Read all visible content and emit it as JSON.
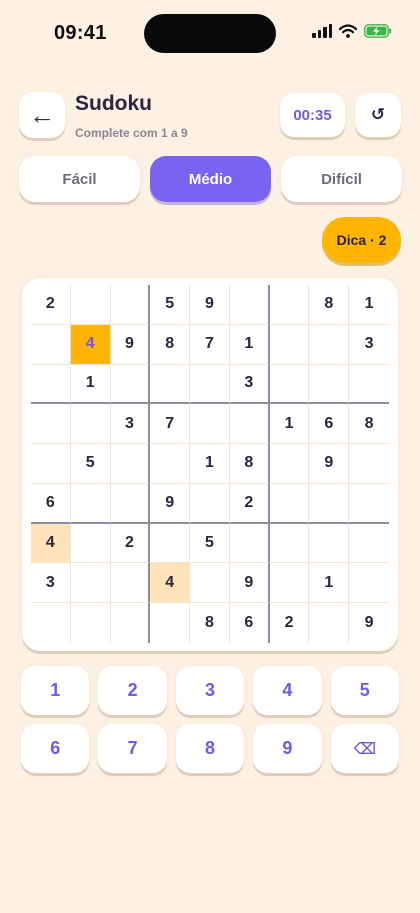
{
  "status_bar": {
    "time": "09:41"
  },
  "header": {
    "back_icon": "←",
    "title": "Sudoku",
    "subtitle": "Complete com 1 a 9",
    "timer": "00:35",
    "reset_icon": "↺"
  },
  "difficulty": {
    "options": [
      "Fácil",
      "Médio",
      "Difícil"
    ],
    "selected": "Médio"
  },
  "hint": {
    "label": "Dica · 2"
  },
  "board": {
    "rows": [
      [
        "2",
        "",
        "",
        "5",
        "9",
        "",
        "",
        "8",
        "1"
      ],
      [
        "",
        "4",
        "9",
        "8",
        "7",
        "1",
        "",
        "",
        "3"
      ],
      [
        "",
        "1",
        "",
        "",
        "",
        "3",
        "",
        "",
        ""
      ],
      [
        "",
        "",
        "3",
        "7",
        "",
        "",
        "1",
        "6",
        "8"
      ],
      [
        "",
        "5",
        "",
        "",
        "1",
        "8",
        "",
        "9",
        ""
      ],
      [
        "6",
        "",
        "",
        "9",
        "",
        "2",
        "",
        "",
        ""
      ],
      [
        "4",
        "",
        "2",
        "",
        "5",
        "",
        "",
        "",
        ""
      ],
      [
        "3",
        "",
        "",
        "4",
        "",
        "9",
        "",
        "1",
        ""
      ],
      [
        "",
        "",
        "",
        "",
        "8",
        "6",
        "2",
        "",
        "9"
      ]
    ],
    "selected_cell": {
      "row": 2,
      "col": 2,
      "color": "#FFB400"
    },
    "highlighted_cells": [
      {
        "row": 7,
        "col": 1
      },
      {
        "row": 8,
        "col": 4
      }
    ],
    "highlight_color": "#FEE4B8"
  },
  "keypad": {
    "keys": [
      "1",
      "2",
      "3",
      "4",
      "5",
      "6",
      "7",
      "8",
      "9",
      "⌫"
    ],
    "delete_icon_name": "backspace-icon"
  },
  "colors": {
    "accent": "#7963F2",
    "accent_text": "#6F5AE8",
    "hint": "#FFB400",
    "background": "#FDF1E4"
  }
}
